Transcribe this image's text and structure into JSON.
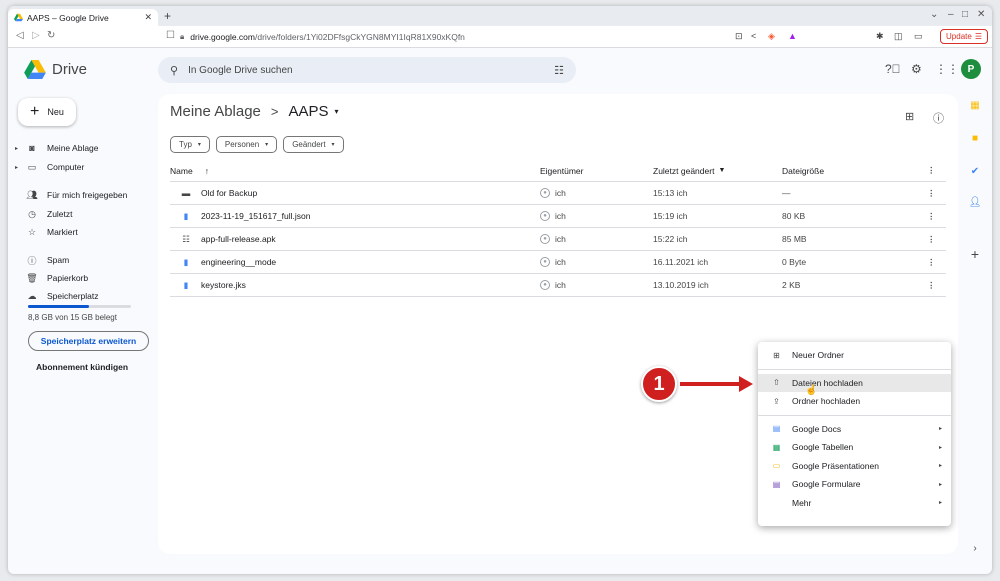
{
  "browser": {
    "tab_title": "AAPS – Google Drive",
    "url_host": "drive.google.com",
    "url_path": "/drive/folders/1Yi02DFfsgCkYGN8MYI1IqR81X90xKQfn",
    "update_label": "Update"
  },
  "header": {
    "app_name": "Drive",
    "search_placeholder": "In Google Drive suchen",
    "avatar_letter": "P"
  },
  "sidebar": {
    "new_label": "Neu",
    "items": [
      {
        "label": "Meine Ablage",
        "icon": "drive-icon"
      },
      {
        "label": "Computer",
        "icon": "computer-icon"
      },
      {
        "label": "Für mich freigegeben",
        "icon": "shared-icon"
      },
      {
        "label": "Zuletzt",
        "icon": "clock-icon"
      },
      {
        "label": "Markiert",
        "icon": "star-icon"
      },
      {
        "label": "Spam",
        "icon": "spam-icon"
      },
      {
        "label": "Papierkorb",
        "icon": "trash-icon"
      },
      {
        "label": "Speicherplatz",
        "icon": "cloud-icon"
      }
    ],
    "storage_text": "8,8 GB von 15 GB belegt",
    "storage_fraction": 0.59,
    "extend_label": "Speicherplatz erweitern",
    "cancel_label": "Abonnement kündigen"
  },
  "main": {
    "breadcrumb_root": "Meine Ablage",
    "breadcrumb_current": "AAPS",
    "chips": [
      "Typ",
      "Personen",
      "Geändert"
    ],
    "columns": {
      "name": "Name",
      "owner": "Eigentümer",
      "modified": "Zuletzt geändert",
      "size": "Dateigröße"
    },
    "rows": [
      {
        "name": "Old for Backup",
        "owner": "ich",
        "modified": "15:13 ich",
        "size": "—"
      },
      {
        "name": "2023-11-19_151617_full.json",
        "owner": "ich",
        "modified": "15:19 ich",
        "size": "80 KB"
      },
      {
        "name": "app-full-release.apk",
        "owner": "ich",
        "modified": "15:22 ich",
        "size": "85 MB"
      },
      {
        "name": "engineering__mode",
        "owner": "ich",
        "modified": "16.11.2021 ich",
        "size": "0 Byte"
      },
      {
        "name": "keystore.jks",
        "owner": "ich",
        "modified": "13.10.2019 ich",
        "size": "2 KB"
      }
    ]
  },
  "context_menu": {
    "items": [
      {
        "label": "Neuer Ordner"
      },
      {
        "label": "Dateien hochladen"
      },
      {
        "label": "Ordner hochladen"
      },
      {
        "label": "Google Docs"
      },
      {
        "label": "Google Tabellen"
      },
      {
        "label": "Google Präsentationen"
      },
      {
        "label": "Google Formulare"
      },
      {
        "label": "Mehr"
      }
    ]
  },
  "annotation": {
    "step_number": "1"
  },
  "colors": {
    "accent": "#0b57d0",
    "badge": "#d01f1f"
  }
}
